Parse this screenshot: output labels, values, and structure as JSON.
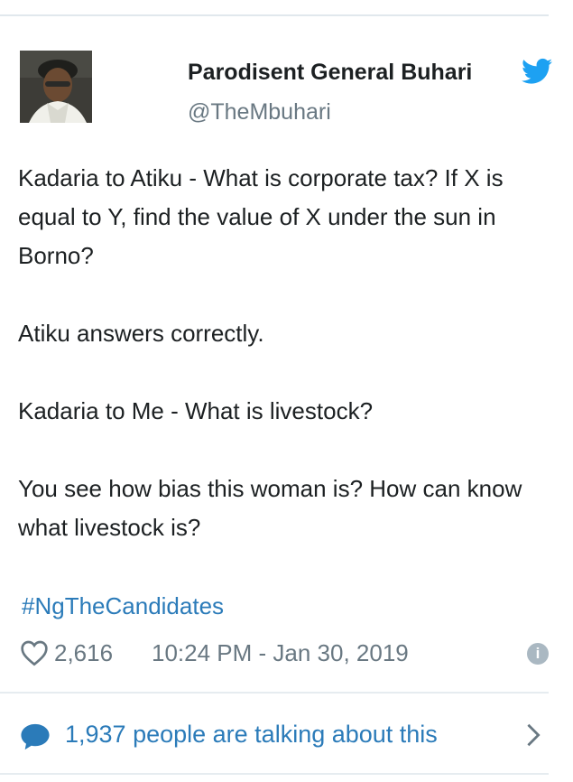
{
  "tweet": {
    "author_name": "Parodisent General Buhari",
    "author_handle": "@TheMbuhari",
    "paragraphs": [
      "Kadaria to Atiku - What is corporate tax? If X is equal to Y, find the value of X under the sun in Borno?",
      "Atiku answers correctly.",
      "Kadaria to Me - What is livestock?",
      "You see how bias this woman is? How can know what livestock is?"
    ],
    "hashtag": "#NgTheCandidates",
    "likes": "2,616",
    "timestamp": "10:24 PM - Jan 30, 2019",
    "info_glyph": "i",
    "talking": "1,937 people are talking about this"
  },
  "icons": {
    "brand": "twitter-bird-icon",
    "like": "heart-icon",
    "info": "info-icon",
    "reply": "speech-bubble-icon",
    "more": "chevron-right-icon"
  },
  "colors": {
    "link": "#2b7bb9",
    "muted": "#697882",
    "text": "#1c2022",
    "brand": "#1da1f2",
    "divider": "#e6ecf0"
  }
}
